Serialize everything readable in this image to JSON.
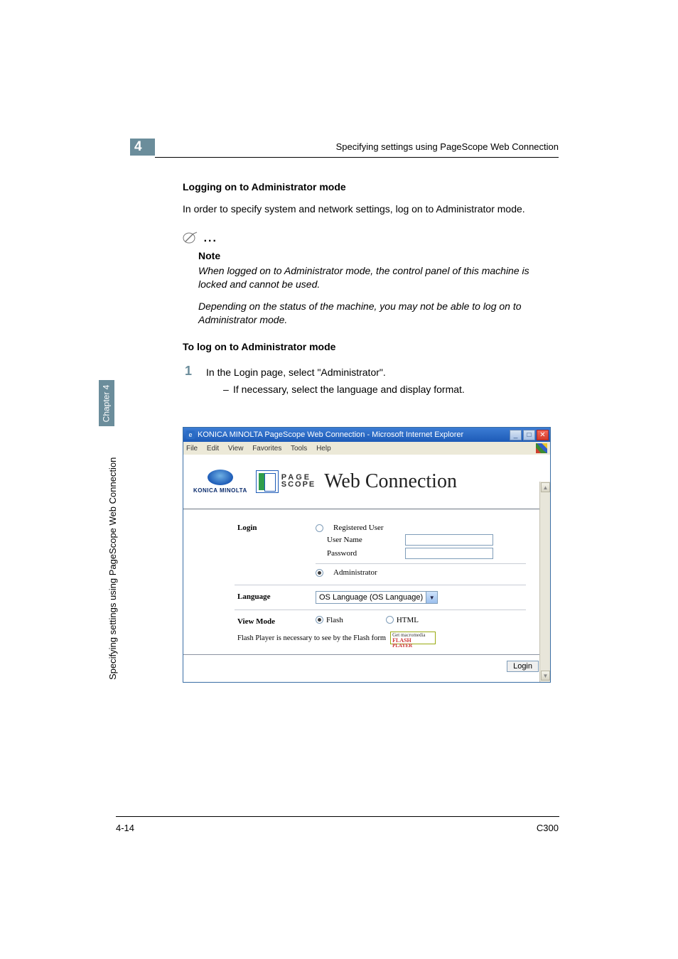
{
  "chapter_number": "4",
  "header": "Specifying settings using PageScope Web Connection",
  "sidebar_tab": "Chapter 4",
  "sidebar_label": "Specifying settings using PageScope Web Connection",
  "section1_title": "Logging on to Administrator mode",
  "section1_body": "In order to specify system and network settings, log on to Administrator mode.",
  "note_label": "Note",
  "note_body1": "When logged on to Administrator mode, the control panel of this machine is locked and cannot be used.",
  "note_body2": "Depending on the status of the machine, you may not be able to log on to Administrator mode.",
  "section2_title": "To log on to Administrator mode",
  "step1_text": "In the Login page, select \"Administrator\".",
  "step1_sub": "If necessary, select the language and display format.",
  "browser": {
    "title": "KONICA MINOLTA PageScope Web Connection - Microsoft Internet Explorer",
    "menus": {
      "file": "File",
      "edit": "Edit",
      "view": "View",
      "favorites": "Favorites",
      "tools": "Tools",
      "help": "Help"
    },
    "brand_km": "KONICA MINOLTA",
    "brand_ps1": "PAGE",
    "brand_ps2": "SCOPE",
    "brand_wc": "Web Connection",
    "form": {
      "login_label": "Login",
      "registered_user": "Registered User",
      "user_name": "User Name",
      "password": "Password",
      "administrator": "Administrator",
      "language_label": "Language",
      "language_value": "OS Language (OS Language)",
      "viewmode_label": "View Mode",
      "viewmode_flash": "Flash",
      "viewmode_html": "HTML",
      "flash_note": "Flash Player is necessary to see by the Flash form",
      "flash_badge1": "Get macromedia",
      "flash_badge2": "FLASH",
      "flash_badge3": "PLAYER",
      "login_button": "Login"
    }
  },
  "footer_page": "4-14",
  "footer_model": "C300"
}
